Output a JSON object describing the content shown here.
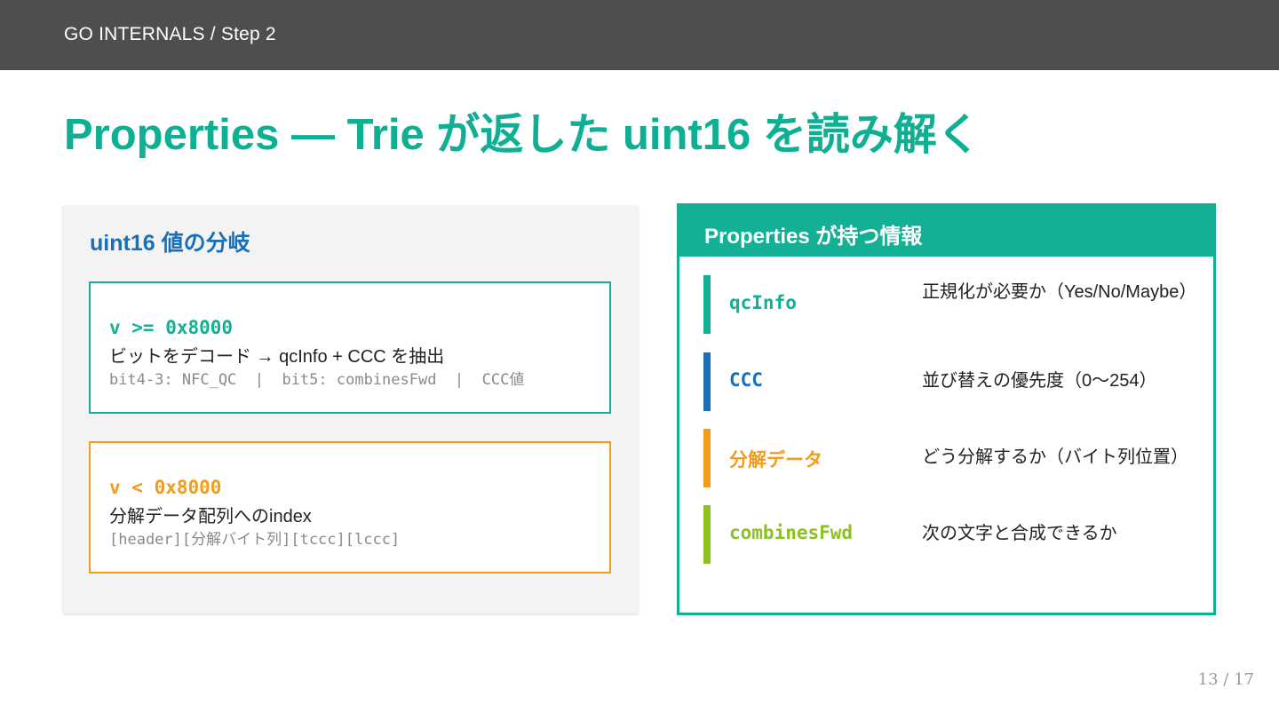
{
  "header": {
    "breadcrumb": "GO INTERNALS / Step 2"
  },
  "title": "Properties — Trie が返した uint16 を読み解く",
  "left_panel": {
    "heading": "uint16 値の分岐",
    "branches": [
      {
        "condition": "v >= 0x8000",
        "description": "ビットをデコード → qcInfo + CCC を抽出",
        "detail": "bit4-3: NFC_QC  |  bit5: combinesFwd  |  CCC値",
        "color": "#14b096"
      },
      {
        "condition": "v < 0x8000",
        "description": "分解データ配列へのindex",
        "detail": "[header][分解バイト列][tccc][lccc]",
        "color": "#f39c1a"
      }
    ]
  },
  "right_panel": {
    "heading": "Properties が持つ情報",
    "rows": [
      {
        "name": "qcInfo",
        "description": "正規化が必要か（Yes/No/Maybe）",
        "color": "#14b096"
      },
      {
        "name": "CCC",
        "description": "並び替えの優先度（0〜254）",
        "color": "#1a6fb8"
      },
      {
        "name": "分解データ",
        "description": "どう分解するか（バイト列位置）",
        "color": "#f39c1a"
      },
      {
        "name": "combinesFwd",
        "description": "次の文字と合成できるか",
        "color": "#8cc21f"
      }
    ]
  },
  "page": {
    "indicator": "13 / 17"
  },
  "colors": {
    "topbar": "#4e4e4e",
    "accent": "#0faf93",
    "heading_blue": "#1a6fb8"
  }
}
